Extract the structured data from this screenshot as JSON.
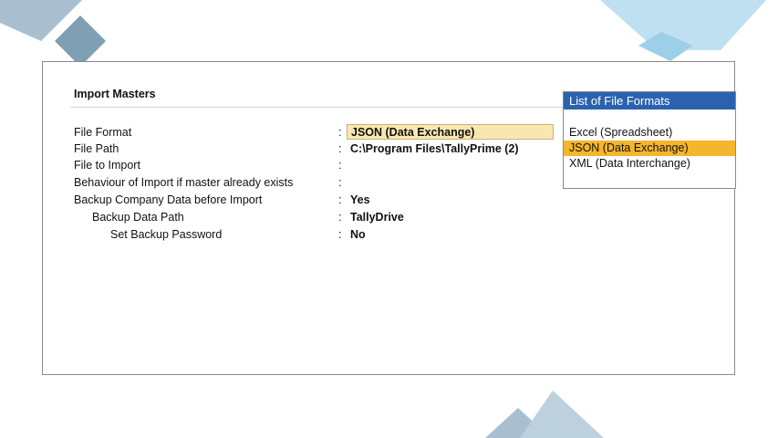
{
  "window": {
    "title": "Import Masters"
  },
  "fields": [
    {
      "label": "File Format",
      "value": "JSON (Data Exchange)"
    },
    {
      "label": "File Path",
      "value": "C:\\Program Files\\TallyPrime (2)"
    },
    {
      "label": "File to Import",
      "value": ""
    },
    {
      "label": "Behaviour of Import if master already exists",
      "value": ""
    },
    {
      "label": "Backup Company Data before Import",
      "value": "Yes"
    },
    {
      "label": "Backup Data Path",
      "value": "TallyDrive"
    },
    {
      "label": "Set Backup Password",
      "value": "No"
    }
  ],
  "separator": ":",
  "file_formats": {
    "title": "List of File Formats",
    "items": [
      "Excel (Spreadsheet)",
      "JSON (Data Exchange)",
      "XML (Data Interchange)"
    ],
    "selected": "JSON (Data Exchange)"
  },
  "colors": {
    "panel_header": "#2b62b0",
    "selected_item": "#f5b52c",
    "field_highlight": "#f9e7b0",
    "decoration_dark": "#7f9fb5",
    "decoration_light": "#bfe0f0"
  }
}
